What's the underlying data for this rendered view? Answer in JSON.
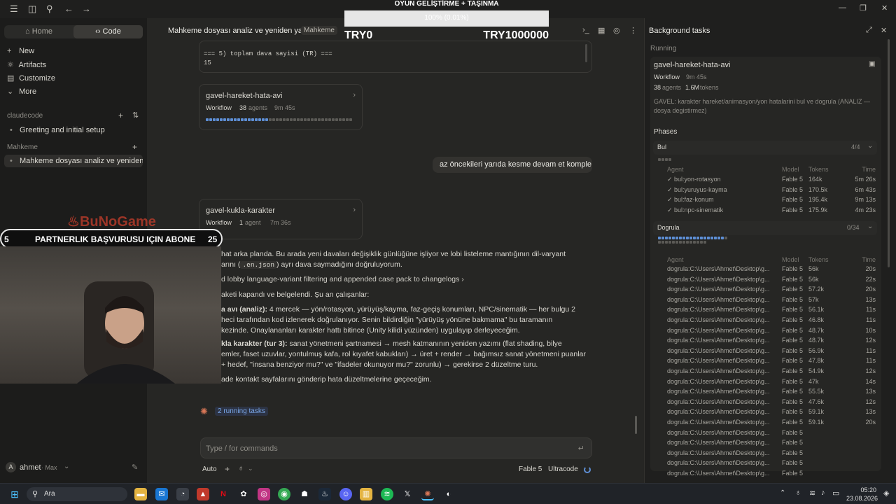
{
  "overlay": {
    "title": "OYUN GELİŞTİRME + TAŞINMA",
    "progress_text": "100% (0.01%)",
    "progress": 1.0,
    "left_amount": "TRY0",
    "right_amount": "TRY1000000"
  },
  "sidebar": {
    "home_label": "Home",
    "code_label": "Code",
    "items": [
      {
        "label": "New",
        "icon": "plus-icon"
      },
      {
        "label": "Artifacts",
        "icon": "artifacts-icon"
      },
      {
        "label": "Customize",
        "icon": "customize-icon"
      },
      {
        "label": "More",
        "icon": "chevron-down-icon"
      }
    ],
    "section1": "claudecode",
    "section1_items": [
      "Greeting and initial setup"
    ],
    "section2": "Mahkeme",
    "section2_items": [
      "Mahkeme dosyası analiz ve yeniden ya"
    ],
    "user": "ahmet",
    "plan": "· Max"
  },
  "stream": {
    "logo": "BuNoGame",
    "banner_left": "5",
    "banner_text": "PARTNERLIK BAŞVURUSU IÇIN ABONE",
    "banner_right": "25"
  },
  "main": {
    "title": "Mahkeme dosyası analiz ve yeniden yazım",
    "badge": "Mahkeme",
    "code_line1": "=== 5) toplam dava sayisi (TR) ===",
    "code_line2": "15",
    "wf1": {
      "name": "gavel-hareket-hata-avi",
      "type": "Workflow",
      "agents": "38",
      "agents_label": "agents",
      "time": "9m 45s"
    },
    "user_msg": "az öncekileri yarıda kesme devam et komple",
    "wf2": {
      "name": "gavel-kukla-karakter",
      "type": "Workflow",
      "agents": "1",
      "agents_label": "agent",
      "time": "7m 36s"
    },
    "p1": "hat arka planda. Bu arada yeni davaları değişiklik günlüğüne işliyor ve lobi listeleme mantığının dil-varyant",
    "p1b_pre": "arını (",
    "p1b_code": ".en.json",
    "p1b_post": ") ayrı dava saymadığını doğruluyorum.",
    "link": "d lobby language-variant filtering and appended case pack to changelogs",
    "p2": "aketi kapandı ve belgelendi. Şu an çalışanlar:",
    "b1_bold": "a avı (analiz):",
    "b1_rest": " 4 mercek — yön/rotasyon, yürüyüş/kayma, faz-geçiş konumları, NPC/sinematik — her bulgu 2",
    "b1_l2": "heci tarafından kod izlenerek doğrulanıyor. Senin bildirdiğin \"yürüyüş yönüne bakmama\" bu taramanın",
    "b1_l3": "kezinde. Onaylananları karakter hattı bitince (Unity kilidi yüzünden) uygulayıp derleyeceğim.",
    "b2_bold": "kla karakter (tur 3):",
    "b2_rest": " sanat yönetmeni şartnamesi → mesh katmanının yeniden yazımı (flat shading, bilye",
    "b2_l2": "emler, faset uzuvlar, yontulmuş kafa, rol kıyafet kabukları) → üret + render → bağımsız sanat yönetmeni puanlar",
    "b2_l3": "+ hedef, \"insana benziyor mu?\" ve \"ifadeler okunuyor mu?\" zorunlu) → gerekirse 2 düzeltme turu.",
    "p3": "ade kontakt sayfalarını gönderip hata düzeltmelerine geçeceğim.",
    "running": "2 running tasks",
    "input_placeholder": "Type / for commands",
    "mode": "Auto",
    "model": "Fable 5",
    "effort": "Ultracode"
  },
  "panel": {
    "title": "Background tasks",
    "running_label": "Running",
    "task_name": "gavel-hareket-hata-avi",
    "task_type": "Workflow",
    "task_time": "9m 45s",
    "agents_count": "38",
    "agents_label": "agents",
    "tokens_count": "1.6M",
    "tokens_label": "tokens",
    "desc": "GAVEL: karakter hareket/animasyon/yon hatalarini bul ve dogrula (ANALIZ — dosya degistirmez)",
    "phases_label": "Phases",
    "headers": {
      "agent": "Agent",
      "model": "Model",
      "tokens": "Tokens",
      "time": "Time"
    },
    "phase1": {
      "name": "Bul",
      "count": "4/4",
      "rows": [
        {
          "agent": "bul:yon-rotasyon",
          "model": "Fable 5",
          "tokens": "164k",
          "time": "5m 26s"
        },
        {
          "agent": "bul:yuruyus-kayma",
          "model": "Fable 5",
          "tokens": "170.5k",
          "time": "6m 43s"
        },
        {
          "agent": "bul:faz-konum",
          "model": "Fable 5",
          "tokens": "195.4k",
          "time": "9m 13s"
        },
        {
          "agent": "bul:npc-sinematik",
          "model": "Fable 5",
          "tokens": "175.9k",
          "time": "4m 23s"
        }
      ]
    },
    "phase2": {
      "name": "Dogrula",
      "count": "0/34",
      "rows": [
        {
          "agent": "dogrula:C:\\Users\\Ahmet\\Desktop\\g...",
          "model": "Fable 5",
          "tokens": "56k",
          "time": "20s"
        },
        {
          "agent": "dogrula:C:\\Users\\Ahmet\\Desktop\\g...",
          "model": "Fable 5",
          "tokens": "56k",
          "time": "22s"
        },
        {
          "agent": "dogrula:C:\\Users\\Ahmet\\Desktop\\g...",
          "model": "Fable 5",
          "tokens": "57.2k",
          "time": "20s"
        },
        {
          "agent": "dogrula:C:\\Users\\Ahmet\\Desktop\\g...",
          "model": "Fable 5",
          "tokens": "57k",
          "time": "13s"
        },
        {
          "agent": "dogrula:C:\\Users\\Ahmet\\Desktop\\g...",
          "model": "Fable 5",
          "tokens": "56.1k",
          "time": "11s"
        },
        {
          "agent": "dogrula:C:\\Users\\Ahmet\\Desktop\\g...",
          "model": "Fable 5",
          "tokens": "46.8k",
          "time": "11s"
        },
        {
          "agent": "dogrula:C:\\Users\\Ahmet\\Desktop\\g...",
          "model": "Fable 5",
          "tokens": "48.7k",
          "time": "10s"
        },
        {
          "agent": "dogrula:C:\\Users\\Ahmet\\Desktop\\g...",
          "model": "Fable 5",
          "tokens": "48.7k",
          "time": "12s"
        },
        {
          "agent": "dogrula:C:\\Users\\Ahmet\\Desktop\\g...",
          "model": "Fable 5",
          "tokens": "56.9k",
          "time": "11s"
        },
        {
          "agent": "dogrula:C:\\Users\\Ahmet\\Desktop\\g...",
          "model": "Fable 5",
          "tokens": "47.8k",
          "time": "11s"
        },
        {
          "agent": "dogrula:C:\\Users\\Ahmet\\Desktop\\g...",
          "model": "Fable 5",
          "tokens": "54.9k",
          "time": "12s"
        },
        {
          "agent": "dogrula:C:\\Users\\Ahmet\\Desktop\\g...",
          "model": "Fable 5",
          "tokens": "47k",
          "time": "14s"
        },
        {
          "agent": "dogrula:C:\\Users\\Ahmet\\Desktop\\g...",
          "model": "Fable 5",
          "tokens": "55.5k",
          "time": "13s"
        },
        {
          "agent": "dogrula:C:\\Users\\Ahmet\\Desktop\\g...",
          "model": "Fable 5",
          "tokens": "47.6k",
          "time": "12s"
        },
        {
          "agent": "dogrula:C:\\Users\\Ahmet\\Desktop\\g...",
          "model": "Fable 5",
          "tokens": "59.1k",
          "time": "13s"
        },
        {
          "agent": "dogrula:C:\\Users\\Ahmet\\Desktop\\g...",
          "model": "Fable 5",
          "tokens": "59.1k",
          "time": "20s"
        }
      ],
      "rows_pending": [
        {
          "agent": "dogrula:C:\\Users\\Ahmet\\Desktop\\g...",
          "model": "Fable 5"
        },
        {
          "agent": "dogrula:C:\\Users\\Ahmet\\Desktop\\g...",
          "model": "Fable 5"
        },
        {
          "agent": "dogrula:C:\\Users\\Ahmet\\Desktop\\g...",
          "model": "Fable 5"
        },
        {
          "agent": "dogrula:C:\\Users\\Ahmet\\Desktop\\g...",
          "model": "Fable 5"
        },
        {
          "agent": "dogrula:C:\\Users\\Ahmet\\Desktop\\g...",
          "model": "Fable 5"
        }
      ]
    }
  },
  "taskbar": {
    "search": "Ara",
    "time": "05:20",
    "date": "23.08.2026"
  }
}
